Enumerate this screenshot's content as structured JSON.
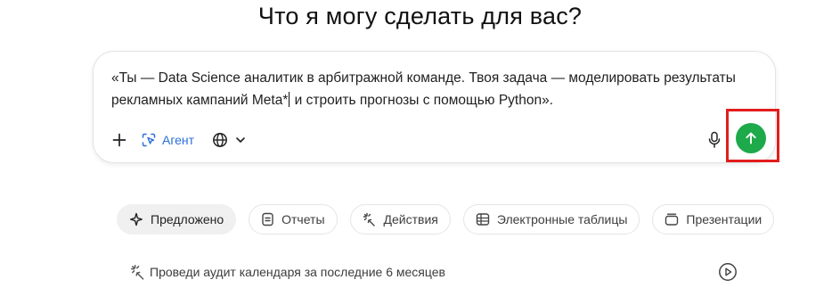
{
  "heading": "Что я могу сделать для вас?",
  "composer": {
    "prompt_before_caret": "«Ты — Data Science аналитик в арбитражной команде. Твоя задача — моделировать результаты рекламных кампаний Meta*",
    "prompt_after_caret": " и строить прогнозы с помощью Python».",
    "agent_label": "Агент",
    "accent_color": "#1ea94b",
    "highlight_color": "#e21d1d"
  },
  "chips": [
    {
      "label": "Предложено",
      "icon": "sparkle-icon",
      "active": true
    },
    {
      "label": "Отчеты",
      "icon": "document-icon",
      "active": false
    },
    {
      "label": "Действия",
      "icon": "action-burst-icon",
      "active": false
    },
    {
      "label": "Электронные таблицы",
      "icon": "spreadsheet-icon",
      "active": false
    },
    {
      "label": "Презентации",
      "icon": "presentation-icon",
      "active": false
    }
  ],
  "suggestion": {
    "text": "Проведи аудит календаря за последние 6 месяцев",
    "icon": "action-burst-icon"
  }
}
